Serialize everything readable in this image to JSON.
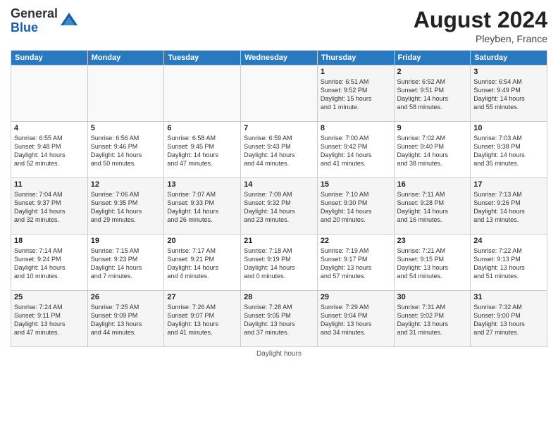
{
  "header": {
    "logo_general": "General",
    "logo_blue": "Blue",
    "month_year": "August 2024",
    "location": "Pleyben, France"
  },
  "footer": {
    "text": "Daylight hours"
  },
  "columns": [
    "Sunday",
    "Monday",
    "Tuesday",
    "Wednesday",
    "Thursday",
    "Friday",
    "Saturday"
  ],
  "weeks": [
    [
      {
        "day": "",
        "info": ""
      },
      {
        "day": "",
        "info": ""
      },
      {
        "day": "",
        "info": ""
      },
      {
        "day": "",
        "info": ""
      },
      {
        "day": "1",
        "info": "Sunrise: 6:51 AM\nSunset: 9:52 PM\nDaylight: 15 hours\nand 1 minute."
      },
      {
        "day": "2",
        "info": "Sunrise: 6:52 AM\nSunset: 9:51 PM\nDaylight: 14 hours\nand 58 minutes."
      },
      {
        "day": "3",
        "info": "Sunrise: 6:54 AM\nSunset: 9:49 PM\nDaylight: 14 hours\nand 55 minutes."
      }
    ],
    [
      {
        "day": "4",
        "info": "Sunrise: 6:55 AM\nSunset: 9:48 PM\nDaylight: 14 hours\nand 52 minutes."
      },
      {
        "day": "5",
        "info": "Sunrise: 6:56 AM\nSunset: 9:46 PM\nDaylight: 14 hours\nand 50 minutes."
      },
      {
        "day": "6",
        "info": "Sunrise: 6:58 AM\nSunset: 9:45 PM\nDaylight: 14 hours\nand 47 minutes."
      },
      {
        "day": "7",
        "info": "Sunrise: 6:59 AM\nSunset: 9:43 PM\nDaylight: 14 hours\nand 44 minutes."
      },
      {
        "day": "8",
        "info": "Sunrise: 7:00 AM\nSunset: 9:42 PM\nDaylight: 14 hours\nand 41 minutes."
      },
      {
        "day": "9",
        "info": "Sunrise: 7:02 AM\nSunset: 9:40 PM\nDaylight: 14 hours\nand 38 minutes."
      },
      {
        "day": "10",
        "info": "Sunrise: 7:03 AM\nSunset: 9:38 PM\nDaylight: 14 hours\nand 35 minutes."
      }
    ],
    [
      {
        "day": "11",
        "info": "Sunrise: 7:04 AM\nSunset: 9:37 PM\nDaylight: 14 hours\nand 32 minutes."
      },
      {
        "day": "12",
        "info": "Sunrise: 7:06 AM\nSunset: 9:35 PM\nDaylight: 14 hours\nand 29 minutes."
      },
      {
        "day": "13",
        "info": "Sunrise: 7:07 AM\nSunset: 9:33 PM\nDaylight: 14 hours\nand 26 minutes."
      },
      {
        "day": "14",
        "info": "Sunrise: 7:09 AM\nSunset: 9:32 PM\nDaylight: 14 hours\nand 23 minutes."
      },
      {
        "day": "15",
        "info": "Sunrise: 7:10 AM\nSunset: 9:30 PM\nDaylight: 14 hours\nand 20 minutes."
      },
      {
        "day": "16",
        "info": "Sunrise: 7:11 AM\nSunset: 9:28 PM\nDaylight: 14 hours\nand 16 minutes."
      },
      {
        "day": "17",
        "info": "Sunrise: 7:13 AM\nSunset: 9:26 PM\nDaylight: 14 hours\nand 13 minutes."
      }
    ],
    [
      {
        "day": "18",
        "info": "Sunrise: 7:14 AM\nSunset: 9:24 PM\nDaylight: 14 hours\nand 10 minutes."
      },
      {
        "day": "19",
        "info": "Sunrise: 7:15 AM\nSunset: 9:23 PM\nDaylight: 14 hours\nand 7 minutes."
      },
      {
        "day": "20",
        "info": "Sunrise: 7:17 AM\nSunset: 9:21 PM\nDaylight: 14 hours\nand 4 minutes."
      },
      {
        "day": "21",
        "info": "Sunrise: 7:18 AM\nSunset: 9:19 PM\nDaylight: 14 hours\nand 0 minutes."
      },
      {
        "day": "22",
        "info": "Sunrise: 7:19 AM\nSunset: 9:17 PM\nDaylight: 13 hours\nand 57 minutes."
      },
      {
        "day": "23",
        "info": "Sunrise: 7:21 AM\nSunset: 9:15 PM\nDaylight: 13 hours\nand 54 minutes."
      },
      {
        "day": "24",
        "info": "Sunrise: 7:22 AM\nSunset: 9:13 PM\nDaylight: 13 hours\nand 51 minutes."
      }
    ],
    [
      {
        "day": "25",
        "info": "Sunrise: 7:24 AM\nSunset: 9:11 PM\nDaylight: 13 hours\nand 47 minutes."
      },
      {
        "day": "26",
        "info": "Sunrise: 7:25 AM\nSunset: 9:09 PM\nDaylight: 13 hours\nand 44 minutes."
      },
      {
        "day": "27",
        "info": "Sunrise: 7:26 AM\nSunset: 9:07 PM\nDaylight: 13 hours\nand 41 minutes."
      },
      {
        "day": "28",
        "info": "Sunrise: 7:28 AM\nSunset: 9:05 PM\nDaylight: 13 hours\nand 37 minutes."
      },
      {
        "day": "29",
        "info": "Sunrise: 7:29 AM\nSunset: 9:04 PM\nDaylight: 13 hours\nand 34 minutes."
      },
      {
        "day": "30",
        "info": "Sunrise: 7:31 AM\nSunset: 9:02 PM\nDaylight: 13 hours\nand 31 minutes."
      },
      {
        "day": "31",
        "info": "Sunrise: 7:32 AM\nSunset: 9:00 PM\nDaylight: 13 hours\nand 27 minutes."
      }
    ]
  ]
}
